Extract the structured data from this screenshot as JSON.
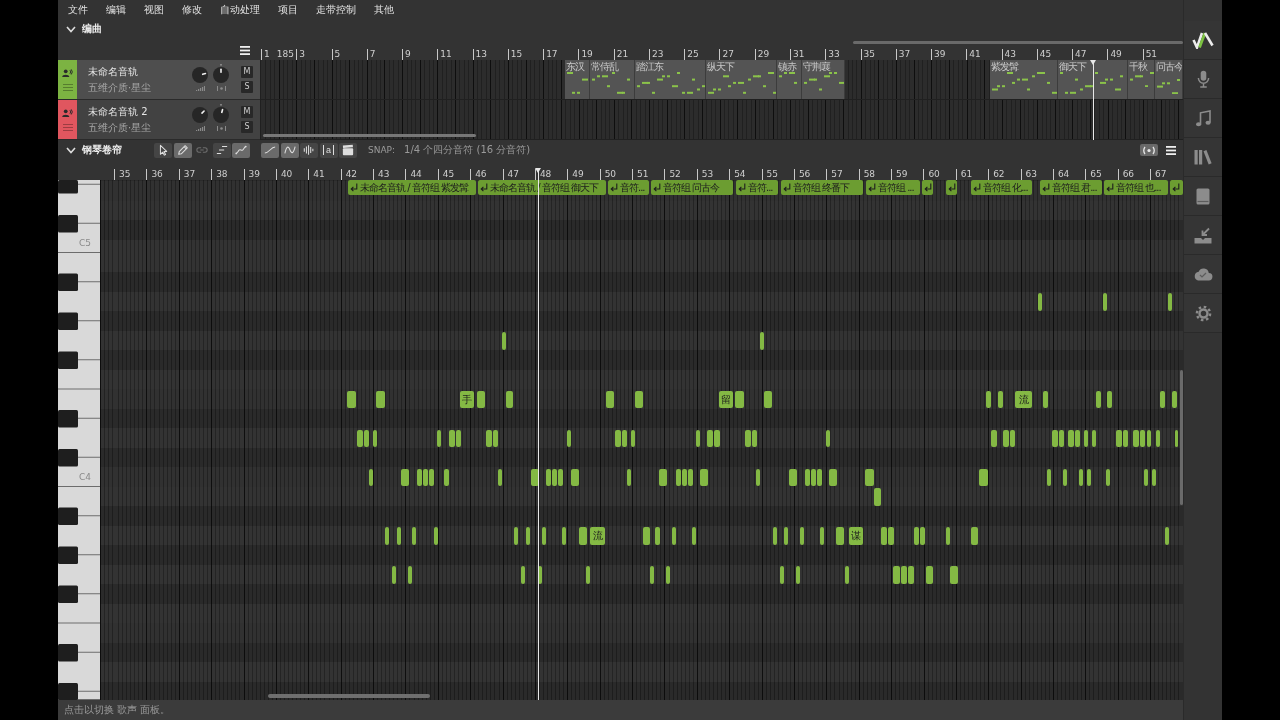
{
  "menu": [
    "文件",
    "编辑",
    "视图",
    "修改",
    "自动处理",
    "项目",
    "走带控制",
    "其他"
  ],
  "arrangement": {
    "title": "编曲",
    "expanded": true,
    "tempo": "185",
    "ruler": [
      "1",
      "3",
      "5",
      "7",
      "9",
      "11",
      "13",
      "15",
      "17",
      "19",
      "21",
      "23",
      "25",
      "27",
      "29",
      "31",
      "33",
      "35",
      "37",
      "39",
      "41",
      "43",
      "45",
      "47",
      "49",
      "51"
    ],
    "tracks": [
      {
        "name": "未命名音轨",
        "singer": "五维介质·星尘",
        "color": "#7cb342",
        "selected": true,
        "knobs": [
          {
            "kind": "volume",
            "level": 0.78
          },
          {
            "kind": "pan",
            "level": 0.5
          }
        ],
        "mute": {
          "label": "M",
          "on": false
        },
        "solo": {
          "label": "S",
          "on": false
        },
        "parts": [
          {
            "label": "东汉"
          },
          {
            "label": "常侍乱"
          },
          {
            "label": "踏江东"
          },
          {
            "label": "纵天下"
          },
          {
            "label": "镇赤"
          },
          {
            "label": "守荆襄"
          },
          {
            "label": "紫发髯"
          },
          {
            "label": "御天下"
          },
          {
            "label": "千秋"
          },
          {
            "label": "问古今"
          }
        ]
      },
      {
        "name": "未命名音轨 2",
        "singer": "五维介质·星尘",
        "color": "#e0565f",
        "selected": false,
        "knobs": [
          {
            "kind": "volume",
            "level": 0.67
          },
          {
            "kind": "pan",
            "level": 0.56
          }
        ],
        "mute": {
          "label": "M",
          "on": false
        },
        "solo": {
          "label": "S",
          "on": false
        }
      }
    ]
  },
  "piano_roll": {
    "title": "钢琴卷帘",
    "expanded": true,
    "tools": [
      {
        "kind": "pointer",
        "selected": false,
        "disabled": false
      },
      {
        "kind": "pencil",
        "selected": true,
        "disabled": false
      },
      {
        "kind": "link",
        "selected": false,
        "disabled": true
      },
      {
        "kind": "steps",
        "selected": false,
        "disabled": false
      },
      {
        "kind": "pitch",
        "selected": true,
        "disabled": false
      }
    ],
    "view_tools": [
      {
        "kind": "curve",
        "selected": true
      },
      {
        "kind": "wave",
        "selected": true
      },
      {
        "kind": "waveform",
        "selected": false
      },
      {
        "kind": "lyric",
        "selected": false,
        "text": "a"
      },
      {
        "kind": "clapper",
        "selected": false
      }
    ],
    "snap_label": "SNAP:",
    "snap_value": "1/4 个四分音符 (16 分音符)",
    "ruler": [
      "35",
      "36",
      "37",
      "38",
      "39",
      "40",
      "41",
      "42",
      "43",
      "44",
      "45",
      "46",
      "47",
      "48",
      "49",
      "50",
      "51",
      "52",
      "53",
      "54",
      "55",
      "56",
      "57",
      "58",
      "59",
      "60",
      "61",
      "62",
      "63",
      "64",
      "65",
      "66",
      "67"
    ],
    "key_labels": [
      "C5",
      "C4"
    ],
    "parts": [
      {
        "kind": "labeled",
        "label": "未命名音轨 / 音符组 紫发髯"
      },
      {
        "kind": "labeled",
        "label": "未命名音轨 / 音符组 御天下"
      },
      {
        "kind": "labeled",
        "label": "音符..."
      },
      {
        "kind": "labeled",
        "label": "音符组 问古今"
      },
      {
        "kind": "labeled",
        "label": "音符..."
      },
      {
        "kind": "labeled",
        "label": "音符组 终番下"
      },
      {
        "kind": "labeled",
        "label": "音符组 ..."
      },
      {
        "kind": "icon"
      },
      {
        "kind": "icon"
      },
      {
        "kind": "labeled",
        "label": "音符组 化..."
      },
      {
        "kind": "labeled",
        "label": "音符组 君..."
      },
      {
        "kind": "labeled",
        "label": "音符组 也..."
      },
      {
        "kind": "icon"
      }
    ],
    "lyrics": [
      "手",
      "留",
      "流",
      "流",
      "谋"
    ]
  },
  "sidebar": [
    {
      "kind": "logo"
    },
    {
      "kind": "microphone"
    },
    {
      "kind": "note"
    },
    {
      "kind": "library"
    },
    {
      "kind": "book"
    },
    {
      "kind": "install"
    },
    {
      "kind": "cloud"
    },
    {
      "kind": "settings"
    }
  ],
  "status_bar": "点击以切换 歌声 面板。"
}
